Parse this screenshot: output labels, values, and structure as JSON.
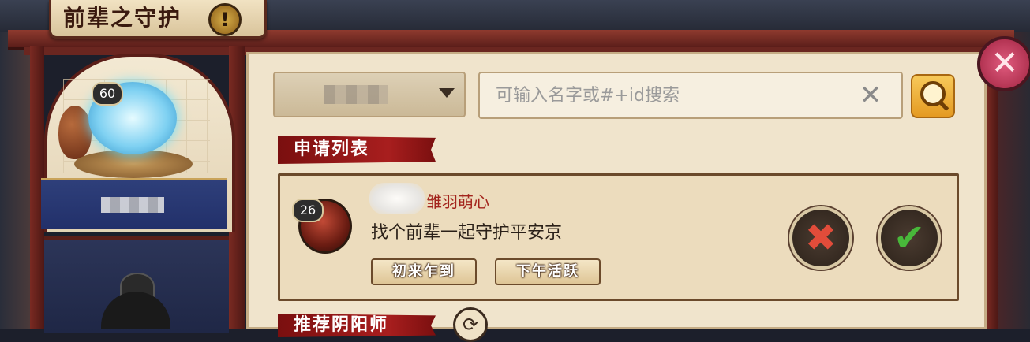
{
  "header": {
    "title": "前辈之守护",
    "info_symbol": "!"
  },
  "left_panel": {
    "level": "60"
  },
  "search": {
    "placeholder": "可输入名字或#+id搜索",
    "value": ""
  },
  "sections": {
    "apply_list": "申请列表",
    "recommend": "推荐阴阳师"
  },
  "application": {
    "level": "26",
    "name": "雏羽萌心",
    "message": "找个前辈一起守护平安京",
    "tags": [
      "初来乍到",
      "下午活跃"
    ],
    "reject_symbol": "✖",
    "accept_symbol": "✔"
  },
  "icons": {
    "close": "✕",
    "clear": "✕",
    "refresh": "⟳"
  },
  "colors": {
    "accent_red": "#a81e1e",
    "name_red": "#a3241c",
    "accept_green": "#48b83a",
    "reject_red": "#e24c3a",
    "search_orange": "#e49a22"
  }
}
